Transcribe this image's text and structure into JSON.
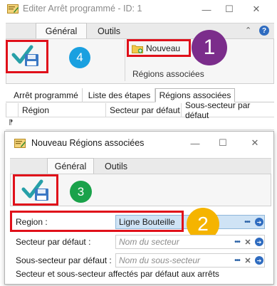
{
  "window": {
    "title": "Editer Arrêt programmé - ID: 1",
    "minimize_glyph": "—",
    "maximize_glyph": "☐",
    "close_glyph": "✕"
  },
  "ribbon": {
    "tabs": [
      {
        "label": "Général"
      },
      {
        "label": "Outils"
      }
    ],
    "collapse_glyph": "⌃",
    "help_glyph": "?",
    "nouveau_label": "Nouveau",
    "group_label": "Régions associées"
  },
  "callouts": {
    "one": "1",
    "two": "2",
    "three": "3",
    "four": "4",
    "colors": {
      "one": "#7b2d8b",
      "two": "#f5b400",
      "three": "#1aa24a",
      "four": "#1aa0e0",
      "highlight": "#e0101a"
    }
  },
  "subtabs": [
    {
      "label": "Arrêt programmé"
    },
    {
      "label": "Liste des étapes"
    },
    {
      "label": "Régions associées"
    }
  ],
  "grid": {
    "columns": [
      "Région",
      "Secteur par défaut",
      "Sous-secteur par défaut"
    ],
    "row_marker": "⁋"
  },
  "dialog": {
    "title": "Nouveau Régions associées",
    "minimize_glyph": "—",
    "maximize_glyph": "☐",
    "close_glyph": "✕",
    "tabs": [
      {
        "label": "Général"
      },
      {
        "label": "Outils"
      }
    ],
    "fields": {
      "region": {
        "label": "Region :",
        "value": "Ligne Bouteille"
      },
      "secteur": {
        "label": "Secteur par défaut :",
        "placeholder": "Nom du secteur"
      },
      "sous_secteur": {
        "label": "Sous-secteur par défaut :",
        "placeholder": "Nom du sous-secteur"
      }
    },
    "footer": "Secteur et sous-secteur affectés par défaut aux arrêts"
  },
  "icons": {
    "dots": "•••",
    "clear": "✕",
    "go": "➔"
  }
}
